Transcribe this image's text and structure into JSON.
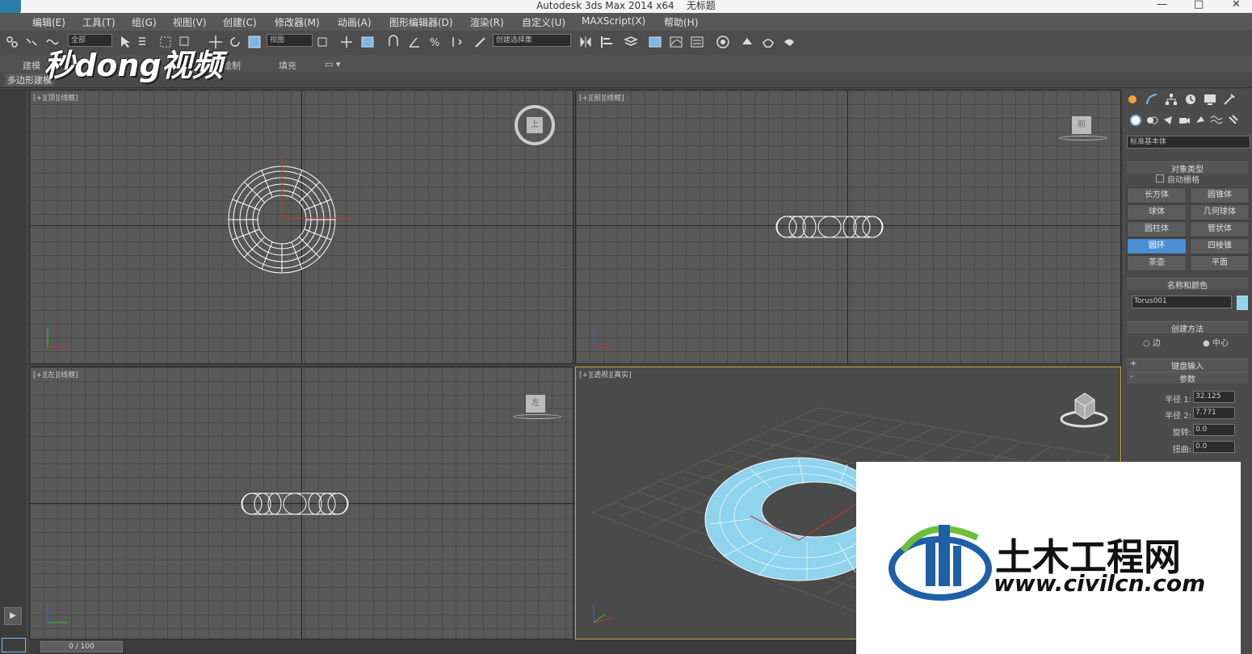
{
  "window": {
    "title": "Autodesk 3ds Max  2014 x64",
    "doc": "无标题",
    "minimize": "—",
    "maximize": "□",
    "close": "✕"
  },
  "menu": [
    "编辑(E)",
    "工具(T)",
    "组(G)",
    "视图(V)",
    "创建(C)",
    "修改器(M)",
    "动画(A)",
    "图形编辑器(D)",
    "渲染(R)",
    "自定义(U)",
    "MAXScript(X)",
    "帮助(H)"
  ],
  "toolbar": {
    "selection_filter": "全部",
    "ref_coord": "视图",
    "named_selection": "创建选择集"
  },
  "ribbon": {
    "tab_model": "建模",
    "tab_paint": "绘制",
    "tab_fill": "填充",
    "sub_tab": "多边形建模"
  },
  "viewports": {
    "top": {
      "label": "[+][顶][线框]",
      "cube": "上"
    },
    "front": {
      "label": "[+][前][线框]",
      "cube": "前"
    },
    "left": {
      "label": "[+][左][线框]",
      "cube": "左"
    },
    "persp": {
      "label": "[+][透视][真实]"
    }
  },
  "cmd": {
    "dropdown": "标准基本体",
    "object_type_title": "对象类型",
    "autogrid": "自动栅格",
    "buttons": [
      "长方体",
      "圆锥体",
      "球体",
      "几何球体",
      "圆柱体",
      "管状体",
      "圆环",
      "四棱锥",
      "茶壶",
      "平面"
    ],
    "active_button": "圆环",
    "name_color_title": "名称和颜色",
    "object_name": "Torus001",
    "object_color": "#8ed6f0",
    "creation_method_title": "创建方法",
    "method_edge": "边",
    "method_center": "中心",
    "keyboard_title": "键盘输入",
    "params_title": "参数",
    "params": [
      {
        "label": "半径 1:",
        "value": "32.125"
      },
      {
        "label": "半径 2:",
        "value": "7.771"
      },
      {
        "label": "旋转:",
        "value": "0.0"
      },
      {
        "label": "扭曲:",
        "value": "0.0"
      }
    ]
  },
  "timeline": {
    "frame": "0 / 100"
  },
  "watermarks": {
    "top_left": "秒dong视频",
    "bottom_cn": "土木工程网",
    "bottom_url": "www.civilcn.com"
  }
}
